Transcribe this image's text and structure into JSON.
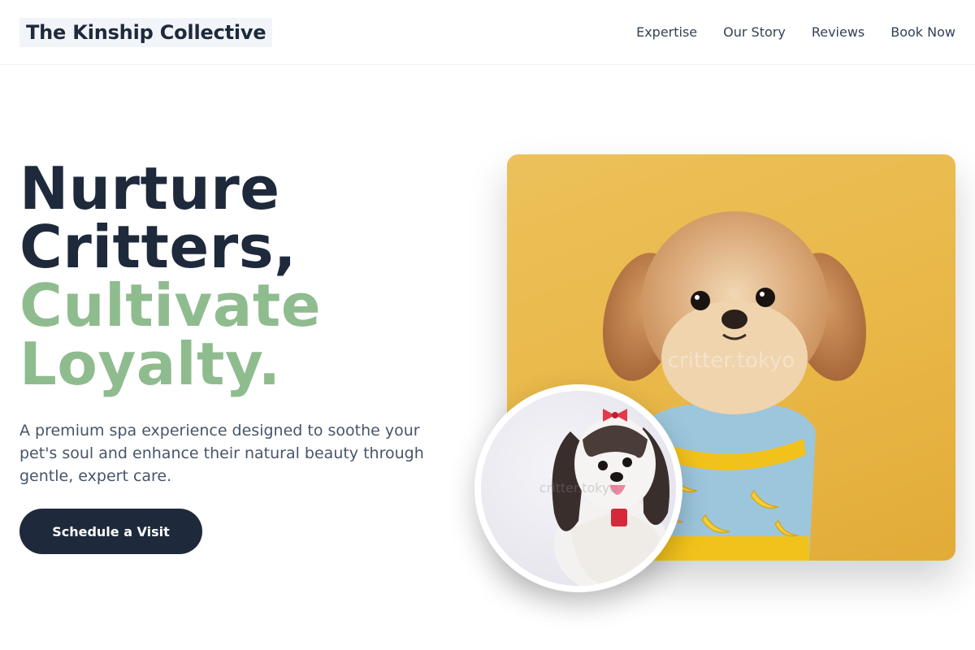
{
  "brand": {
    "name": "The Kinship Collective"
  },
  "nav": {
    "items": [
      {
        "label": "Expertise"
      },
      {
        "label": "Our Story"
      },
      {
        "label": "Reviews"
      },
      {
        "label": "Book Now"
      }
    ]
  },
  "hero": {
    "headline_line1": "Nurture",
    "headline_line2": "Critters,",
    "headline_line3": "Cultivate",
    "headline_line4": "Loyalty.",
    "subtitle": "A premium spa experience designed to soothe your pet's soul and enhance their natural beauty through gentle, expert care.",
    "cta_label": "Schedule a Visit"
  },
  "images": {
    "main_watermark": "critter.tokyo",
    "circle_watermark": "critter.tokyo"
  },
  "colors": {
    "dark": "#1e293b",
    "accent_green": "#8fbc8f",
    "photo_yellow": "#e8b645"
  }
}
